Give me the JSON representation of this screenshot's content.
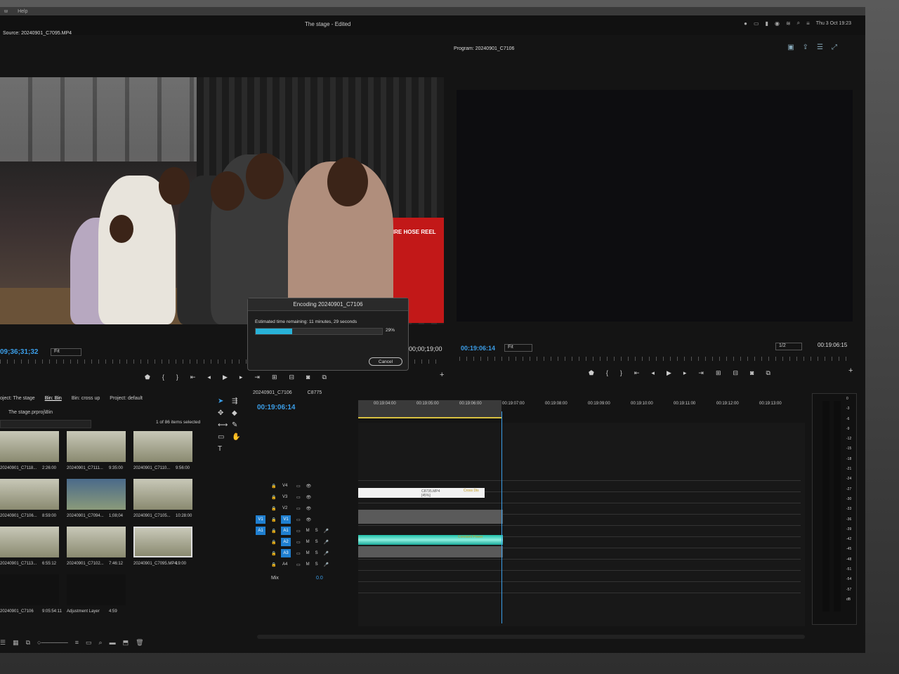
{
  "menubar": {
    "items": [
      "w",
      "Help"
    ]
  },
  "title": "The stage - Edited",
  "tray": {
    "date": "Thu 3 Oct  19:23"
  },
  "source": {
    "title": "Source: 20240901_C7095.MP4",
    "timecode": "09;36;31;32",
    "fit": "Fit",
    "duration": "00;00;19;00",
    "sign_text": "FIRE HOSE REEL"
  },
  "program": {
    "title": "Program: 20240901_C7106",
    "timecode": "00:19:06:14",
    "fit": "Fit",
    "resolution": "1/2",
    "end_timecode": "00:19:06:15"
  },
  "encoding": {
    "title": "Encoding 20240901_C7106",
    "eta": "Estimated time remaining: 11 minutes, 29 seconds",
    "progress_percent": 29,
    "progress_label": "29%",
    "cancel": "Cancel"
  },
  "project": {
    "tabs": [
      "oject: The stage",
      "Bin: Bin",
      "Bin: cross up",
      "Project: default"
    ],
    "path": "The stage.prproj\\Bin",
    "count": "1 of 86 items selected",
    "items": [
      {
        "label": "20240901_C7118...",
        "dur": "2:26:00",
        "kind": "room"
      },
      {
        "label": "20240901_C7111...",
        "dur": "9:35:00",
        "kind": "room"
      },
      {
        "label": "20240901_C7110...",
        "dur": "9:56:00",
        "kind": "room"
      },
      {
        "label": "20240901_C7106...",
        "dur": "8:59:00",
        "kind": "room"
      },
      {
        "label": "20240901_C7094...",
        "dur": "1;08;04",
        "kind": "blue"
      },
      {
        "label": "20240901_C7105...",
        "dur": "10:28:00",
        "kind": "room"
      },
      {
        "label": "20240901_C7113...",
        "dur": "6:55:12",
        "kind": "room"
      },
      {
        "label": "20240901_C7102...",
        "dur": "7:46:12",
        "kind": "room"
      },
      {
        "label": "20240901_C7095.MP4",
        "dur": "19:00",
        "kind": "sel"
      },
      {
        "label": "20240901_C7106",
        "dur": "9:05:54:11",
        "kind": "dark"
      },
      {
        "label": "Adjustment Layer",
        "dur": "4:59",
        "kind": "dark"
      }
    ]
  },
  "timeline": {
    "tabs": [
      "20240901_C7106",
      "C8775"
    ],
    "timecode": "00:19:06:14",
    "ruler": [
      "00:19:04:00",
      "00:19:05:00",
      "00:19:06:00",
      "00:19:07:00",
      "00:19:08:00",
      "00:19:09:00",
      "00:19:10:00",
      "00:19:11:00",
      "00:19:12:00",
      "00:19:13:00"
    ],
    "tracks": [
      "V4",
      "V3",
      "V2",
      "V1",
      "A1",
      "A2",
      "A3",
      "A4"
    ],
    "source_patch": [
      "V1",
      "A1"
    ],
    "video_clip": "C8735.MP4 [45%]",
    "video_fx": "Cross Dis",
    "audio_fx": "Constant Power",
    "mix_label": "Mix",
    "mix_value": "0.0"
  },
  "meter": {
    "ticks": [
      "0",
      "-3",
      "-6",
      "-9",
      "-12",
      "-15",
      "-18",
      "-21",
      "-24",
      "-27",
      "-30",
      "-33",
      "-36",
      "-39",
      "-42",
      "-45",
      "-48",
      "-51",
      "-54",
      "-57",
      "dB"
    ],
    "labels": [
      "S",
      "S"
    ]
  }
}
